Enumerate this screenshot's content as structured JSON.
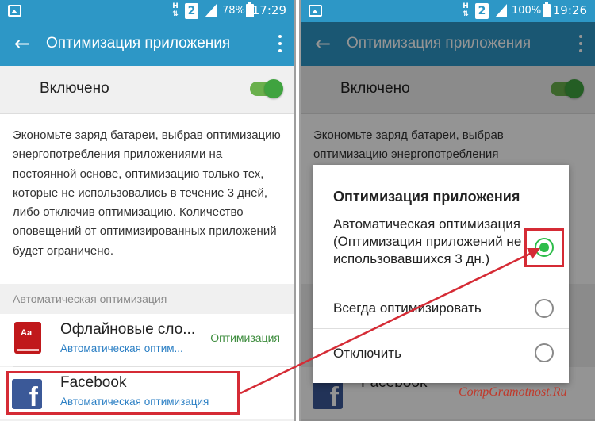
{
  "left_screen": {
    "status_bar": {
      "network": "H",
      "sim": "2",
      "battery": "78%",
      "time": "17:29"
    },
    "app_bar": {
      "title": "Оптимизация приложения",
      "back_icon": "arrow-back-icon",
      "menu_icon": "more-vert-icon"
    },
    "toggle": {
      "label": "Включено",
      "state": "on"
    },
    "description": "Экономьте заряд батареи, выбрав оптимизацию энергопотребления приложениями на постоянной основе, оптимизацию только тех, которые не использовались в течение 3 дней, либо отключив оптимизацию. Количество оповещений от оптимизированных приложений будет ограничено.",
    "section_header": "Автоматическая оптимизация",
    "apps": [
      {
        "name": "Офлайновые сло...",
        "status": "Автоматическая оптим...",
        "right_status": "Оптимизация",
        "icon": "dictionary-icon",
        "icon_text": "Aa"
      },
      {
        "name": "Facebook",
        "status": "Автоматическая оптимизация",
        "icon": "facebook-icon",
        "icon_text": "f"
      }
    ]
  },
  "right_screen": {
    "status_bar": {
      "network": "H",
      "sim": "2",
      "battery": "100%",
      "time": "19:26"
    },
    "app_bar": {
      "title": "Оптимизация приложения"
    },
    "toggle": {
      "label": "Включено"
    },
    "description_visible": "Экономьте заряд батареи, выбрав оптимизацию энергопотребления",
    "background_app": "Facebook",
    "dialog": {
      "title": "Оптимизация приложения",
      "options": [
        {
          "label": "Автоматическая оптимизация (Оптимизация приложений не использовавшихся 3 дн.)",
          "selected": true
        },
        {
          "label": "Всегда оптимизировать",
          "selected": false
        },
        {
          "label": "Отключить",
          "selected": false
        }
      ]
    }
  },
  "watermark": "CompGramotnost.Ru",
  "colors": {
    "status_bar": "#2d97c6",
    "switch_on": "#3fa33f",
    "link_text": "#2b7fc4",
    "highlight": "#d52b35",
    "radio_selected": "#2dbd4a",
    "facebook": "#3b5998"
  }
}
